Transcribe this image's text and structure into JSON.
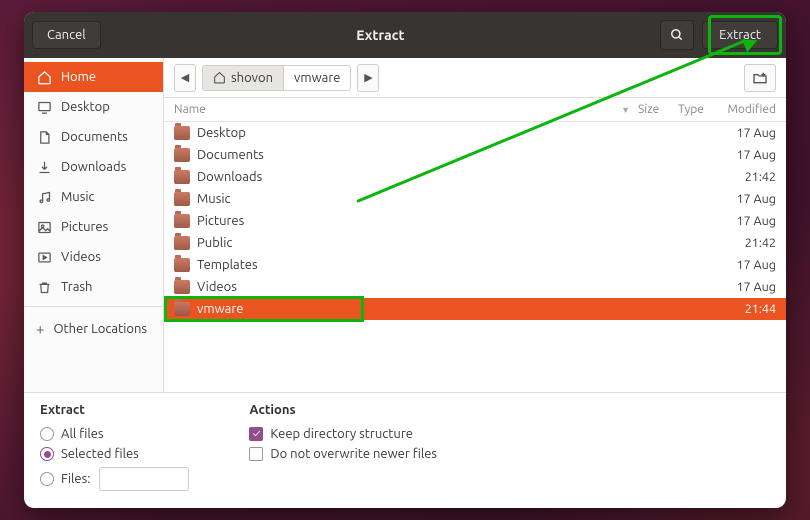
{
  "titlebar": {
    "cancel": "Cancel",
    "title": "Extract",
    "extract": "Extract"
  },
  "sidebar": {
    "items": [
      {
        "label": "Home",
        "icon": "home-icon",
        "active": true
      },
      {
        "label": "Desktop",
        "icon": "desktop-icon"
      },
      {
        "label": "Documents",
        "icon": "documents-icon"
      },
      {
        "label": "Downloads",
        "icon": "downloads-icon"
      },
      {
        "label": "Music",
        "icon": "music-icon"
      },
      {
        "label": "Pictures",
        "icon": "pictures-icon"
      },
      {
        "label": "Videos",
        "icon": "videos-icon"
      },
      {
        "label": "Trash",
        "icon": "trash-icon"
      }
    ],
    "other_locations": "Other Locations"
  },
  "path": {
    "crumbs": [
      "shovon",
      "vmware"
    ]
  },
  "columns": {
    "name": "Name",
    "size": "Size",
    "type": "Type",
    "modified": "Modified"
  },
  "files": [
    {
      "name": "Desktop",
      "modified": "17 Aug"
    },
    {
      "name": "Documents",
      "modified": "17 Aug"
    },
    {
      "name": "Downloads",
      "modified": "21:42"
    },
    {
      "name": "Music",
      "modified": "17 Aug"
    },
    {
      "name": "Pictures",
      "modified": "17 Aug"
    },
    {
      "name": "Public",
      "modified": "21:42"
    },
    {
      "name": "Templates",
      "modified": "17 Aug"
    },
    {
      "name": "Videos",
      "modified": "17 Aug"
    },
    {
      "name": "vmware",
      "modified": "21:44",
      "selected": true
    }
  ],
  "bottom": {
    "extract_heading": "Extract",
    "all_files": "All files",
    "selected_files": "Selected files",
    "files_label": "Files:",
    "files_value": "",
    "actions_heading": "Actions",
    "keep_dir": "Keep directory structure",
    "no_overwrite": "Do not overwrite newer files"
  }
}
